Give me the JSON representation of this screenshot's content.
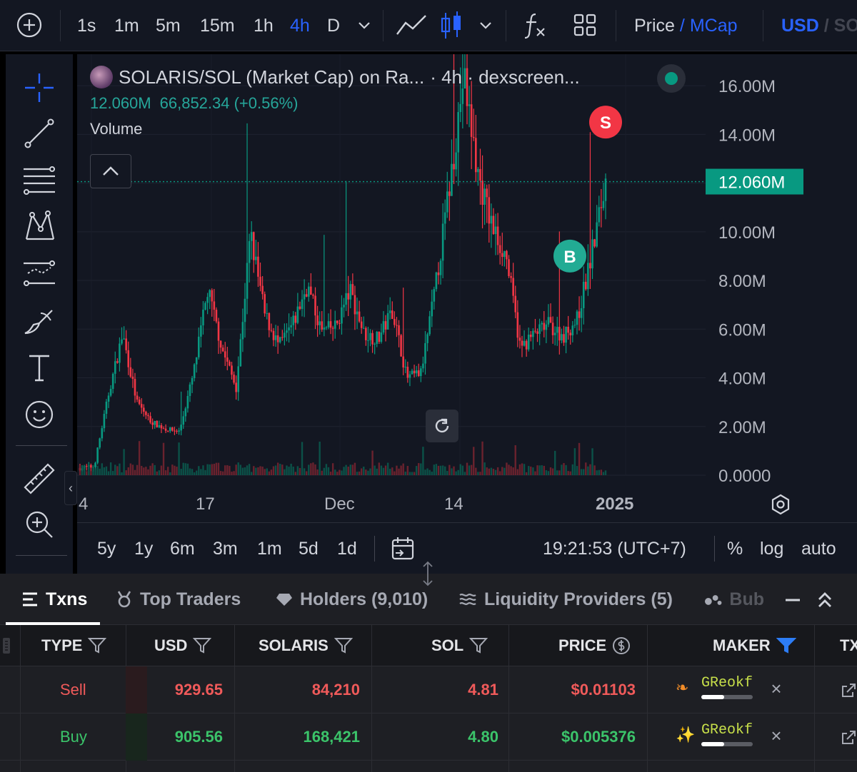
{
  "toolbar": {
    "intervals": [
      "1s",
      "1m",
      "5m",
      "15m",
      "1h",
      "4h",
      "D"
    ],
    "active_interval": "4h",
    "price_label": "Price",
    "slash": "/",
    "mcap_label": "MCap",
    "usd_label": "USD",
    "alt_currency": "SOL"
  },
  "legend": {
    "title": "SOLARIS/SOL (Market Cap) on Ra...",
    "interval_source": "· 4h · dexscreen...",
    "price": "12.060M",
    "change": "66,852.34 (+0.56%)",
    "volume_label": "Volume"
  },
  "chart_data": {
    "type": "candlestick",
    "y_ticks": [
      "16.00M",
      "14.00M",
      "12.00M",
      "10.00M",
      "8.00M",
      "6.00M",
      "4.00M",
      "2.00M",
      "0.0000"
    ],
    "x_ticks": [
      "4",
      "17",
      "Dec",
      "14",
      "2025"
    ],
    "ylim": [
      0,
      17000000
    ],
    "current_price": 12060000,
    "current_price_label": "12.060M",
    "markers": [
      {
        "label": "S",
        "type": "sell",
        "value": 13800000,
        "color": "#f23645"
      },
      {
        "label": "B",
        "type": "buy",
        "value": 8300000,
        "color": "#22ab94"
      }
    ],
    "up_color": "#089981",
    "down_color": "#f23645",
    "approx_closes": [
      300000,
      350000,
      3300000,
      5800000,
      3000000,
      2200000,
      1900000,
      1800000,
      4200000,
      7600000,
      5200000,
      3600000,
      9900000,
      6600000,
      5300000,
      6200000,
      7800000,
      5900000,
      6100000,
      7600000,
      5800000,
      5600000,
      6800000,
      4000000,
      4200000,
      7600000,
      11800000,
      16400000,
      12400000,
      10200000,
      9000000,
      5200000,
      5800000,
      6200000,
      5700000,
      6400000,
      9000000,
      12060000
    ]
  },
  "bottom_bar": {
    "ranges": [
      "5y",
      "1y",
      "6m",
      "3m",
      "1m",
      "5d",
      "1d"
    ],
    "time": "19:21:53 (UTC+7)",
    "percent": "%",
    "log": "log",
    "auto": "auto"
  },
  "tabs": [
    {
      "label": "Txns",
      "icon": "list-icon"
    },
    {
      "label": "Top Traders",
      "icon": "medal-icon"
    },
    {
      "label": "Holders (9,010)",
      "icon": "diamond-icon"
    },
    {
      "label": "Liquidity Providers (5)",
      "icon": "waves-icon"
    },
    {
      "label": "Bub",
      "icon": "bubbles-icon"
    }
  ],
  "table": {
    "headers": [
      "TYPE",
      "USD",
      "SOLARIS",
      "SOL",
      "PRICE",
      "MAKER",
      "TX"
    ],
    "rows": [
      {
        "type": "Sell",
        "usd": "929.65",
        "solaris": "84,210",
        "sol": "4.81",
        "price": "$0.01103",
        "maker": "GReokf",
        "maker_bar": 0.45
      },
      {
        "type": "Buy",
        "usd": "905.56",
        "solaris": "168,421",
        "sol": "4.80",
        "price": "$0.005376",
        "maker": "GReokf",
        "maker_bar": 0.45
      }
    ]
  }
}
